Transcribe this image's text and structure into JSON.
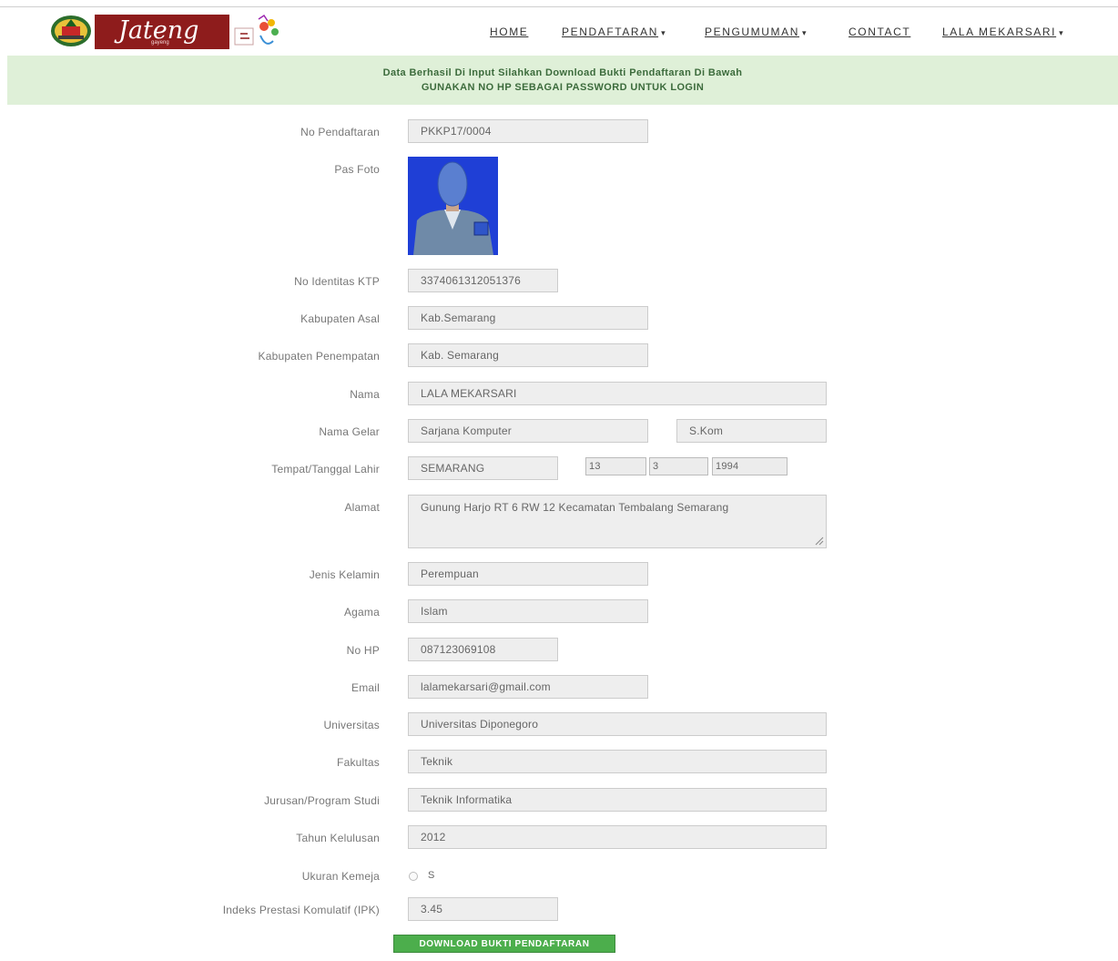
{
  "header": {
    "brand_text": "Jateng",
    "brand_sub": "gayeng",
    "nav": [
      {
        "label": "HOME",
        "caret": false
      },
      {
        "label": "PENDAFTARAN",
        "caret": true
      },
      {
        "label": "PENGUMUMAN",
        "caret": true
      },
      {
        "label": "CONTACT",
        "caret": false
      },
      {
        "label": "LALA MEKARSARI",
        "caret": true
      }
    ]
  },
  "alert": {
    "line1": "Data Berhasil Di Input Silahkan Download Bukti Pendaftaran Di Bawah",
    "line2": "GUNAKAN NO HP SEBAGAI PASSWORD UNTUK LOGIN"
  },
  "form": {
    "no_pendaftaran": {
      "label": "No Pendaftaran",
      "value": "PKKP17/0004"
    },
    "pas_foto": {
      "label": "Pas Foto"
    },
    "no_ktp": {
      "label": "No Identitas KTP",
      "value": "3374061312051376"
    },
    "kab_asal": {
      "label": "Kabupaten Asal",
      "value": "Kab.Semarang"
    },
    "kab_penempatan": {
      "label": "Kabupaten Penempatan",
      "value": "Kab. Semarang"
    },
    "nama": {
      "label": "Nama",
      "value": "LALA MEKARSARI"
    },
    "nama_gelar": {
      "label": "Nama Gelar",
      "value": "Sarjana Komputer",
      "value2": "S.Kom"
    },
    "ttl": {
      "label": "Tempat/Tanggal Lahir",
      "tempat": "SEMARANG",
      "tanggal": "13",
      "bulan": "3",
      "tahun": "1994"
    },
    "alamat": {
      "label": "Alamat",
      "value": "Gunung Harjo RT 6 RW 12 Kecamatan Tembalang Semarang"
    },
    "jenis_kelamin": {
      "label": "Jenis Kelamin",
      "value": "Perempuan"
    },
    "agama": {
      "label": "Agama",
      "value": "Islam"
    },
    "no_hp": {
      "label": "No HP",
      "value": "087123069108"
    },
    "email": {
      "label": "Email",
      "value": "lalamekarsari@gmail.com"
    },
    "universitas": {
      "label": "Universitas",
      "value": "Universitas Diponegoro"
    },
    "fakultas": {
      "label": "Fakultas",
      "value": "Teknik"
    },
    "jurusan": {
      "label": "Jurusan/Program Studi",
      "value": "Teknik Informatika"
    },
    "tahun_lulus": {
      "label": "Tahun Kelulusan",
      "value": "2012"
    },
    "ukuran_kemeja": {
      "label": "Ukuran Kemeja",
      "value": "S"
    },
    "ipk": {
      "label": "Indeks Prestasi Komulatif (IPK)",
      "value": "3.45"
    }
  },
  "download_button": "DOWNLOAD BUKTI PENDAFTARAN"
}
